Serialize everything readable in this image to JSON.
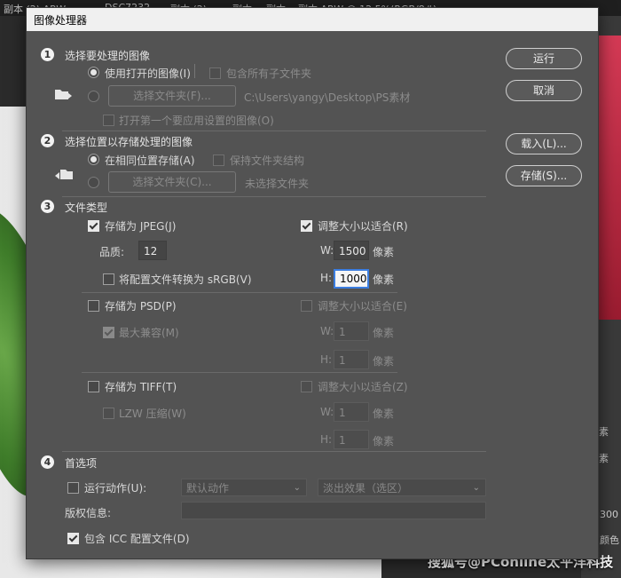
{
  "background": {
    "tabs": [
      "副本 (2).ARW",
      "DSC7232",
      "副本 (2)",
      "副本",
      "副本",
      "副本.ARW @ 12.5%(RGB/8#)"
    ],
    "panel_texts": [
      "素",
      "素",
      "300",
      "颜色"
    ],
    "watermark": "搜狐号@PConline太平洋科技"
  },
  "dialog": {
    "title": "图像处理器",
    "buttons": {
      "run": "运行",
      "cancel": "取消",
      "load": "载入(L)...",
      "save": "存储(S)..."
    },
    "section1": {
      "num": "1",
      "title": "选择要处理的图像",
      "use_open": "使用打开的图像(I)",
      "include_subfolders": "包含所有子文件夹",
      "select_folder": "选择文件夹(F)...",
      "path": "C:\\Users\\yangy\\Desktop\\PS素材",
      "open_first": "打开第一个要应用设置的图像(O)"
    },
    "section2": {
      "num": "2",
      "title": "选择位置以存储处理的图像",
      "same_location": "在相同位置存储(A)",
      "keep_structure": "保持文件夹结构",
      "select_folder": "选择文件夹(C)...",
      "no_folder": "未选择文件夹"
    },
    "section3": {
      "num": "3",
      "title": "文件类型",
      "jpeg": {
        "label": "存储为 JPEG(J)",
        "quality_label": "品质:",
        "quality": "12",
        "convert_srgb": "将配置文件转换为 sRGB(V)",
        "resize": "调整大小以适合(R)",
        "w_label": "W:",
        "w": "1500",
        "w_unit": "像素",
        "h_label": "H:",
        "h": "1000",
        "h_unit": "像素"
      },
      "psd": {
        "label": "存储为 PSD(P)",
        "maximize": "最大兼容(M)",
        "resize": "调整大小以适合(E)",
        "w_label": "W:",
        "w": "1",
        "w_unit": "像素",
        "h_label": "H:",
        "h": "1",
        "h_unit": "像素"
      },
      "tiff": {
        "label": "存储为 TIFF(T)",
        "lzw": "LZW 压缩(W)",
        "resize": "调整大小以适合(Z)",
        "w_label": "W:",
        "w": "1",
        "w_unit": "像素",
        "h_label": "H:",
        "h": "1",
        "h_unit": "像素"
      }
    },
    "section4": {
      "num": "4",
      "title": "首选项",
      "run_action": "运行动作(U):",
      "action_set": "默认动作",
      "action": "淡出效果（选区）",
      "copyright_label": "版权信息:",
      "copyright": "",
      "include_icc": "包含 ICC 配置文件(D)"
    }
  }
}
